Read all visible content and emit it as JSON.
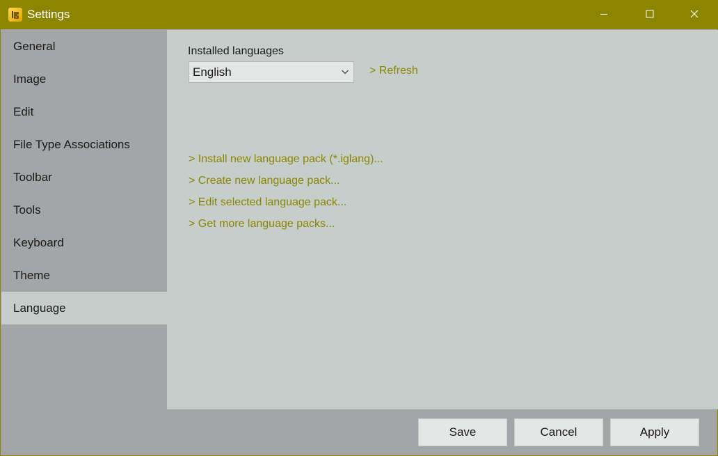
{
  "window": {
    "title": "Settings",
    "app_icon": "imageglass-icon",
    "controls": [
      "minimize-icon",
      "maximize-icon",
      "close-icon"
    ]
  },
  "sidebar": {
    "items": [
      {
        "label": "General",
        "active": false
      },
      {
        "label": "Image",
        "active": false
      },
      {
        "label": "Edit",
        "active": false
      },
      {
        "label": "File Type Associations",
        "active": false
      },
      {
        "label": "Toolbar",
        "active": false
      },
      {
        "label": "Tools",
        "active": false
      },
      {
        "label": "Keyboard",
        "active": false
      },
      {
        "label": "Theme",
        "active": false
      },
      {
        "label": "Language",
        "active": true
      }
    ]
  },
  "language": {
    "installed_label": "Installed languages",
    "selected": "English",
    "refresh_label": ">  Refresh",
    "links": [
      ">  Install new language pack (*.iglang)...",
      ">  Create new language pack...",
      ">  Edit selected language pack...",
      ">  Get more language packs..."
    ]
  },
  "footer": {
    "save_label": "Save",
    "cancel_label": "Cancel",
    "apply_label": "Apply"
  },
  "colors": {
    "accent": "#8c8500",
    "sidebar_bg": "#a3a5a7",
    "content_bg": "#c6cecb",
    "button_bg": "#e5e7e6"
  }
}
